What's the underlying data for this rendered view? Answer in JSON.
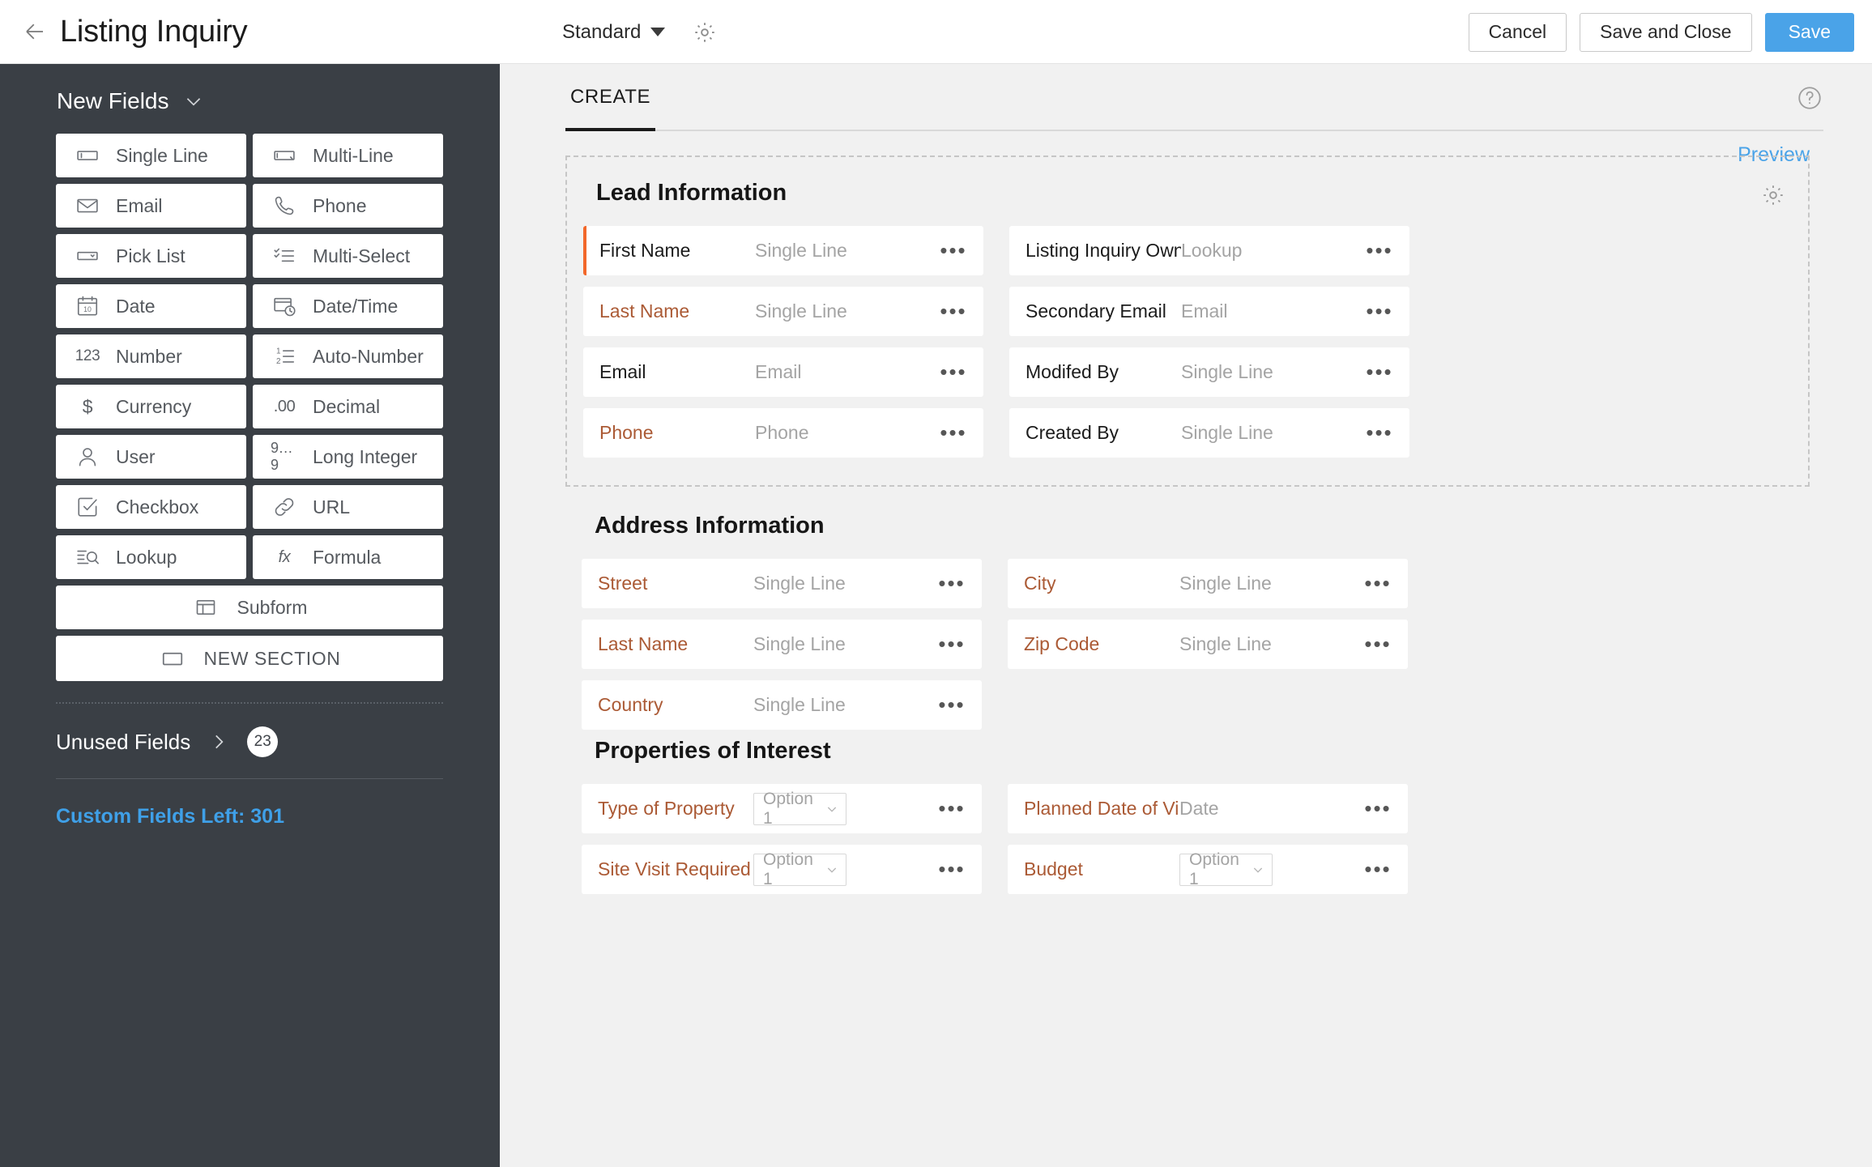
{
  "topbar": {
    "back_icon": "arrow-left-icon",
    "title": "Listing Inquiry",
    "layout_name": "Standard",
    "settings_icon": "gear-icon",
    "cancel_label": "Cancel",
    "save_close_label": "Save and Close",
    "save_label": "Save",
    "primary_color": "#4aa3e8"
  },
  "sidebar": {
    "heading": "New Fields",
    "background": "#3a3f45",
    "fields": [
      {
        "label": "Single Line",
        "icon": "single-line-icon"
      },
      {
        "label": "Multi-Line",
        "icon": "multi-line-icon"
      },
      {
        "label": "Email",
        "icon": "envelope-icon"
      },
      {
        "label": "Phone",
        "icon": "phone-icon"
      },
      {
        "label": "Pick List",
        "icon": "pick-list-icon"
      },
      {
        "label": "Multi-Select",
        "icon": "multi-select-icon"
      },
      {
        "label": "Date",
        "icon": "calendar-icon"
      },
      {
        "label": "Date/Time",
        "icon": "date-time-icon"
      },
      {
        "label": "Number",
        "icon": "123-icon"
      },
      {
        "label": "Auto-Number",
        "icon": "auto-number-icon"
      },
      {
        "label": "Currency",
        "icon": "dollar-icon"
      },
      {
        "label": "Decimal",
        "icon": "decimal-icon"
      },
      {
        "label": "User",
        "icon": "user-icon"
      },
      {
        "label": "Long Integer",
        "icon": "long-integer-icon"
      },
      {
        "label": "Checkbox",
        "icon": "checkbox-icon"
      },
      {
        "label": "URL",
        "icon": "link-icon"
      },
      {
        "label": "Lookup",
        "icon": "lookup-icon"
      },
      {
        "label": "Formula",
        "icon": "fx-icon"
      }
    ],
    "subform_label": "Subform",
    "subform_icon": "subform-icon",
    "new_section_label": "NEW SECTION",
    "new_section_icon": "rectangle-icon",
    "unused_fields_label": "Unused Fields",
    "unused_fields_count": "23",
    "custom_fields_left": "Custom Fields Left: 301",
    "custom_fields_color": "#3fa0e8"
  },
  "main": {
    "tab_label": "CREATE",
    "help_icon": "question-mark-icon",
    "preview_label": "Preview",
    "sections": [
      {
        "title": "Lead Information",
        "boxed": true,
        "gear_icon": "gear-icon",
        "rows": [
          {
            "label": "First Name",
            "type": "Single Line",
            "style": "dark",
            "selected": true,
            "control": "text"
          },
          {
            "label": "Listing Inquiry Owner",
            "type": "Lookup",
            "style": "dark",
            "selected": false,
            "control": "text"
          },
          {
            "label": "Last Name",
            "type": "Single Line",
            "style": "orange",
            "selected": false,
            "control": "text"
          },
          {
            "label": "Secondary Email",
            "type": "Email",
            "style": "dark",
            "selected": false,
            "control": "text"
          },
          {
            "label": "Email",
            "type": "Email",
            "style": "dark",
            "selected": false,
            "control": "text"
          },
          {
            "label": "Modifed By",
            "type": "Single Line",
            "style": "dark",
            "selected": false,
            "control": "text"
          },
          {
            "label": "Phone",
            "type": "Phone",
            "style": "orange",
            "selected": false,
            "control": "text"
          },
          {
            "label": "Created By",
            "type": "Single Line",
            "style": "dark",
            "selected": false,
            "control": "text"
          }
        ]
      },
      {
        "title": "Address Information",
        "boxed": false,
        "rows": [
          {
            "label": "Street",
            "type": "Single Line",
            "style": "orange",
            "selected": false,
            "control": "text"
          },
          {
            "label": "City",
            "type": "Single Line",
            "style": "orange",
            "selected": false,
            "control": "text"
          },
          {
            "label": "Last Name",
            "type": "Single Line",
            "style": "orange",
            "selected": false,
            "control": "text"
          },
          {
            "label": "Zip Code",
            "type": "Single Line",
            "style": "orange",
            "selected": false,
            "control": "text"
          },
          {
            "label": "Country",
            "type": "Single Line",
            "style": "orange",
            "selected": false,
            "control": "text"
          }
        ]
      },
      {
        "title": "Properties of Interest",
        "boxed": false,
        "rows": [
          {
            "label": "Type of Property",
            "type": "Option 1",
            "style": "orange",
            "selected": false,
            "control": "select"
          },
          {
            "label": "Planned Date of Visit",
            "type": "Date",
            "style": "orange",
            "selected": false,
            "control": "text"
          },
          {
            "label": "Site Visit Required",
            "type": "Option 1",
            "style": "orange",
            "selected": false,
            "control": "select"
          },
          {
            "label": "Budget",
            "type": "Option 1",
            "style": "orange",
            "selected": false,
            "control": "select"
          }
        ]
      }
    ],
    "row_dots_icon": "more-options-icon",
    "accent_orange": "#f2682a"
  }
}
